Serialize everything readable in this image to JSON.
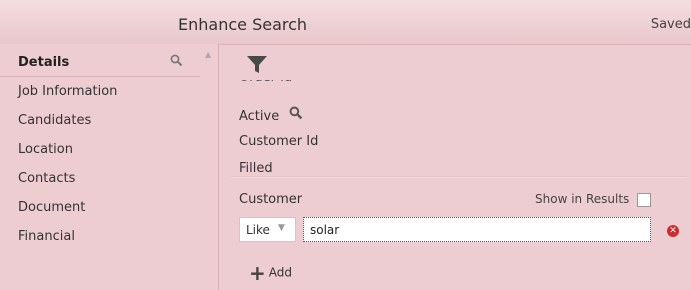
{
  "header": {
    "title": "Enhance Search",
    "saved": "Saved"
  },
  "sidebar": {
    "heading": "Details",
    "items": [
      {
        "label": "Job Information"
      },
      {
        "label": "Candidates"
      },
      {
        "label": "Location"
      },
      {
        "label": "Contacts"
      },
      {
        "label": "Document"
      },
      {
        "label": "Financial"
      }
    ]
  },
  "fields": {
    "order_id": "Order Id",
    "active": "Active",
    "customer_id": "Customer Id",
    "filled": "Filled"
  },
  "criterion": {
    "field_label": "Customer",
    "show_in_results": "Show in Results",
    "operator": "Like",
    "value": "solar"
  },
  "add_label": "Add",
  "colors": {
    "background": "#edcdd2",
    "remove": "#d02b2b"
  }
}
